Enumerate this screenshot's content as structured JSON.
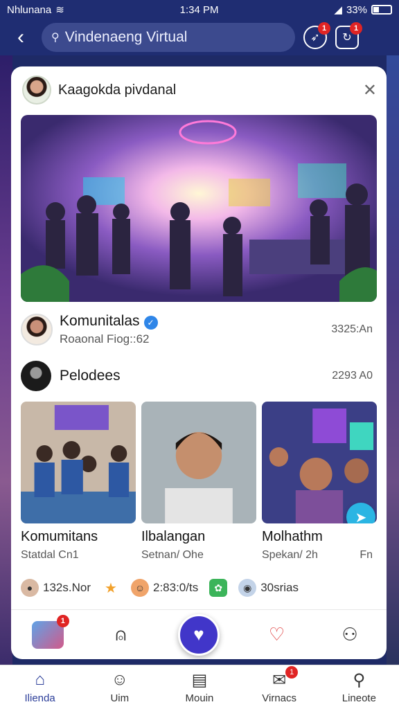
{
  "status_bar": {
    "carrier": "Nhlunana",
    "time": "1:34 PM",
    "battery": "33%"
  },
  "search": {
    "placeholder": "Vindenaeng Virtual"
  },
  "header_icons": {
    "bell_badge": "1",
    "profile_badge": "1"
  },
  "card": {
    "title": "Kaagokda pivdanal",
    "close_icon": "close-icon"
  },
  "post_row": {
    "title": "Komunitalas",
    "subtitle": "Roaonal Fiog::62",
    "time": "3325:An"
  },
  "second_row": {
    "title": "Pelodees",
    "time": "2293 A0"
  },
  "thumbnails": [
    {
      "title": "Komumitans",
      "subtitle": "Statdal Cn1"
    },
    {
      "title": "Ilbalangan",
      "subtitle": "Setnan/ Ohe"
    },
    {
      "title": "Molhathm",
      "subtitle": "Spekan/ 2h",
      "extra": "Fn"
    }
  ],
  "stats": [
    {
      "icon": "user-avatar-icon",
      "text": "132s.Nor"
    },
    {
      "icon": "star-icon",
      "text": ""
    },
    {
      "icon": "face-emoji-icon",
      "text": "2:83:0/ts"
    },
    {
      "icon": "green-app-icon",
      "text": ""
    },
    {
      "icon": "bubble-icon",
      "text": "30srias"
    }
  ],
  "card_actions": {
    "left_badge": "1"
  },
  "bottom_nav": [
    {
      "label": "Ilienda",
      "icon": "home-icon",
      "active": true
    },
    {
      "label": "Uim",
      "icon": "profile-icon"
    },
    {
      "label": "Mouin",
      "icon": "list-icon"
    },
    {
      "label": "Virnacs",
      "icon": "chat-icon",
      "badge": "1"
    },
    {
      "label": "Lineote",
      "icon": "person-icon"
    }
  ],
  "colors": {
    "brand": "#1f2d72",
    "accent": "#4136c9",
    "badge": "#e02424",
    "share": "#2bb5e3"
  }
}
